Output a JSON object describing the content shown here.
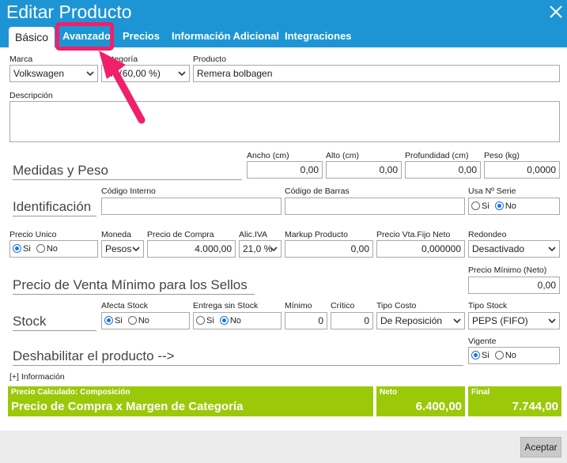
{
  "window": {
    "title": "Editar Producto"
  },
  "tabs": [
    {
      "label": "Básico"
    },
    {
      "label": "Avanzado"
    },
    {
      "label": "Precios"
    },
    {
      "label": "Información Adicional"
    },
    {
      "label": "Integraciones"
    }
  ],
  "fields": {
    "marca": {
      "label": "Marca",
      "value": "Volkswagen"
    },
    "categoria": {
      "label": "Categoría",
      "value": "PA (60,00 %)"
    },
    "producto": {
      "label": "Producto",
      "value": "Remera bolbagen"
    },
    "descripcion": {
      "label": "Descripción",
      "value": ""
    }
  },
  "medidas": {
    "section": "Medidas y Peso",
    "ancho": {
      "label": "Ancho (cm)",
      "value": "0,00"
    },
    "alto": {
      "label": "Alto (cm)",
      "value": "0,00"
    },
    "profundidad": {
      "label": "Profundidad (cm)",
      "value": "0,00"
    },
    "peso": {
      "label": "Peso (kg)",
      "value": "0,0000"
    }
  },
  "identificacion": {
    "section": "Identificación",
    "codigo_interno": {
      "label": "Código Interno",
      "value": ""
    },
    "codigo_barras": {
      "label": "Código de Barras",
      "value": ""
    },
    "usa_serie": {
      "label": "Usa Nº Serie",
      "si": "Si",
      "no": "No"
    }
  },
  "precio": {
    "precio_unico": {
      "label": "Precio Unico",
      "si": "Si",
      "no": "No"
    },
    "moneda": {
      "label": "Moneda",
      "value": "Pesos"
    },
    "precio_compra": {
      "label": "Precio de Compra",
      "value": "4.000,00"
    },
    "alic_iva": {
      "label": "Alic.IVA",
      "value": "21,0 %"
    },
    "markup": {
      "label": "Markup Producto",
      "value": "0,00"
    },
    "precio_vta_fijo": {
      "label": "Precio Vta.Fijo Neto",
      "value": "0,000000"
    },
    "redondeo": {
      "label": "Redondeo",
      "value": "Desactivado"
    }
  },
  "minimo": {
    "section": "Precio de Venta Mínimo para los Sellos",
    "label": "Precio Mínimo (Neto)",
    "value": "0,00"
  },
  "stock": {
    "section": "Stock",
    "afecta": {
      "label": "Afecta Stock",
      "si": "Si",
      "no": "No"
    },
    "entrega": {
      "label": "Entrega sin Stock",
      "si": "Si",
      "no": "No"
    },
    "minimo": {
      "label": "Mínimo",
      "value": "0"
    },
    "critico": {
      "label": "Crítico",
      "value": "0"
    },
    "tipo_costo": {
      "label": "Tipo Costo",
      "value": "De Reposición"
    },
    "tipo_stock": {
      "label": "Tipo Stock",
      "value": "PEPS (FIFO)"
    }
  },
  "deshabilitar": {
    "section": "Deshabilitar el producto -->",
    "vigente": {
      "label": "Vigente",
      "si": "Si",
      "no": "No"
    }
  },
  "info_link": "[+] Información",
  "summary": {
    "composicion": {
      "label": "Precio Calculado: Composición",
      "value": "Precio de Compra x Margen de Categoría"
    },
    "neto": {
      "label": "Neto",
      "value": "6.400,00"
    },
    "final": {
      "label": "Final",
      "value": "7.744,00"
    }
  },
  "footer": {
    "accept": "Aceptar"
  },
  "colors": {
    "header": "#1d95d4",
    "green": "#9bc90a",
    "highlight": "#f0206a",
    "radio": "#1a73e8"
  }
}
